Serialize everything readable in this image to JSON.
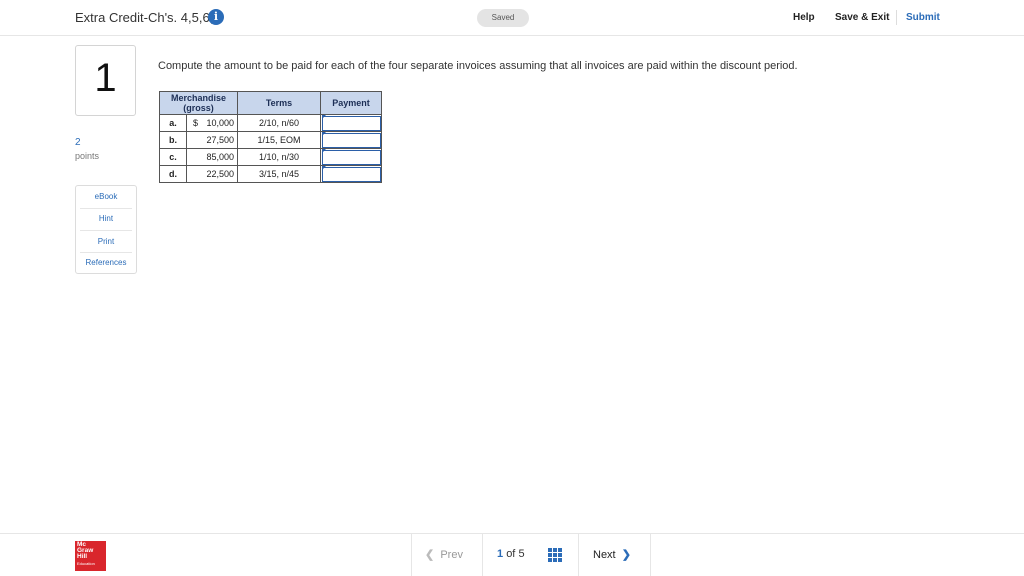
{
  "header": {
    "title": "Extra Credit-Ch's. 4,5,6,7",
    "info_icon": "info-icon",
    "saved_label": "Saved",
    "help_label": "Help",
    "save_exit_label": "Save & Exit",
    "submit_label": "Submit",
    "accent_color": "#2b6cb8"
  },
  "question": {
    "number": "1",
    "points_value": "2",
    "points_label": "points",
    "text": "Compute the amount to be paid for each of the four separate invoices assuming that all invoices are paid within the discount period."
  },
  "tools": {
    "ebook": "eBook",
    "hint": "Hint",
    "print": "Print",
    "references": "References"
  },
  "table": {
    "headers": [
      "Merchandise (gross)",
      "Terms",
      "Payment"
    ],
    "rows": [
      {
        "letter": "a.",
        "currency": "$",
        "amount": "10,000",
        "terms": "2/10, n/60",
        "payment": ""
      },
      {
        "letter": "b.",
        "currency": "",
        "amount": "27,500",
        "terms": "1/15, EOM",
        "payment": ""
      },
      {
        "letter": "c.",
        "currency": "",
        "amount": "85,000",
        "terms": "1/10, n/30",
        "payment": ""
      },
      {
        "letter": "d.",
        "currency": "",
        "amount": "22,500",
        "terms": "3/15, n/45",
        "payment": ""
      }
    ]
  },
  "footer": {
    "logo_lines": [
      "Mc",
      "Graw",
      "Hill",
      "Education"
    ],
    "prev_label": "Prev",
    "current_page": "1",
    "of_label": "of",
    "total_pages": "5",
    "grid_icon": "grid-icon",
    "next_label": "Next"
  }
}
